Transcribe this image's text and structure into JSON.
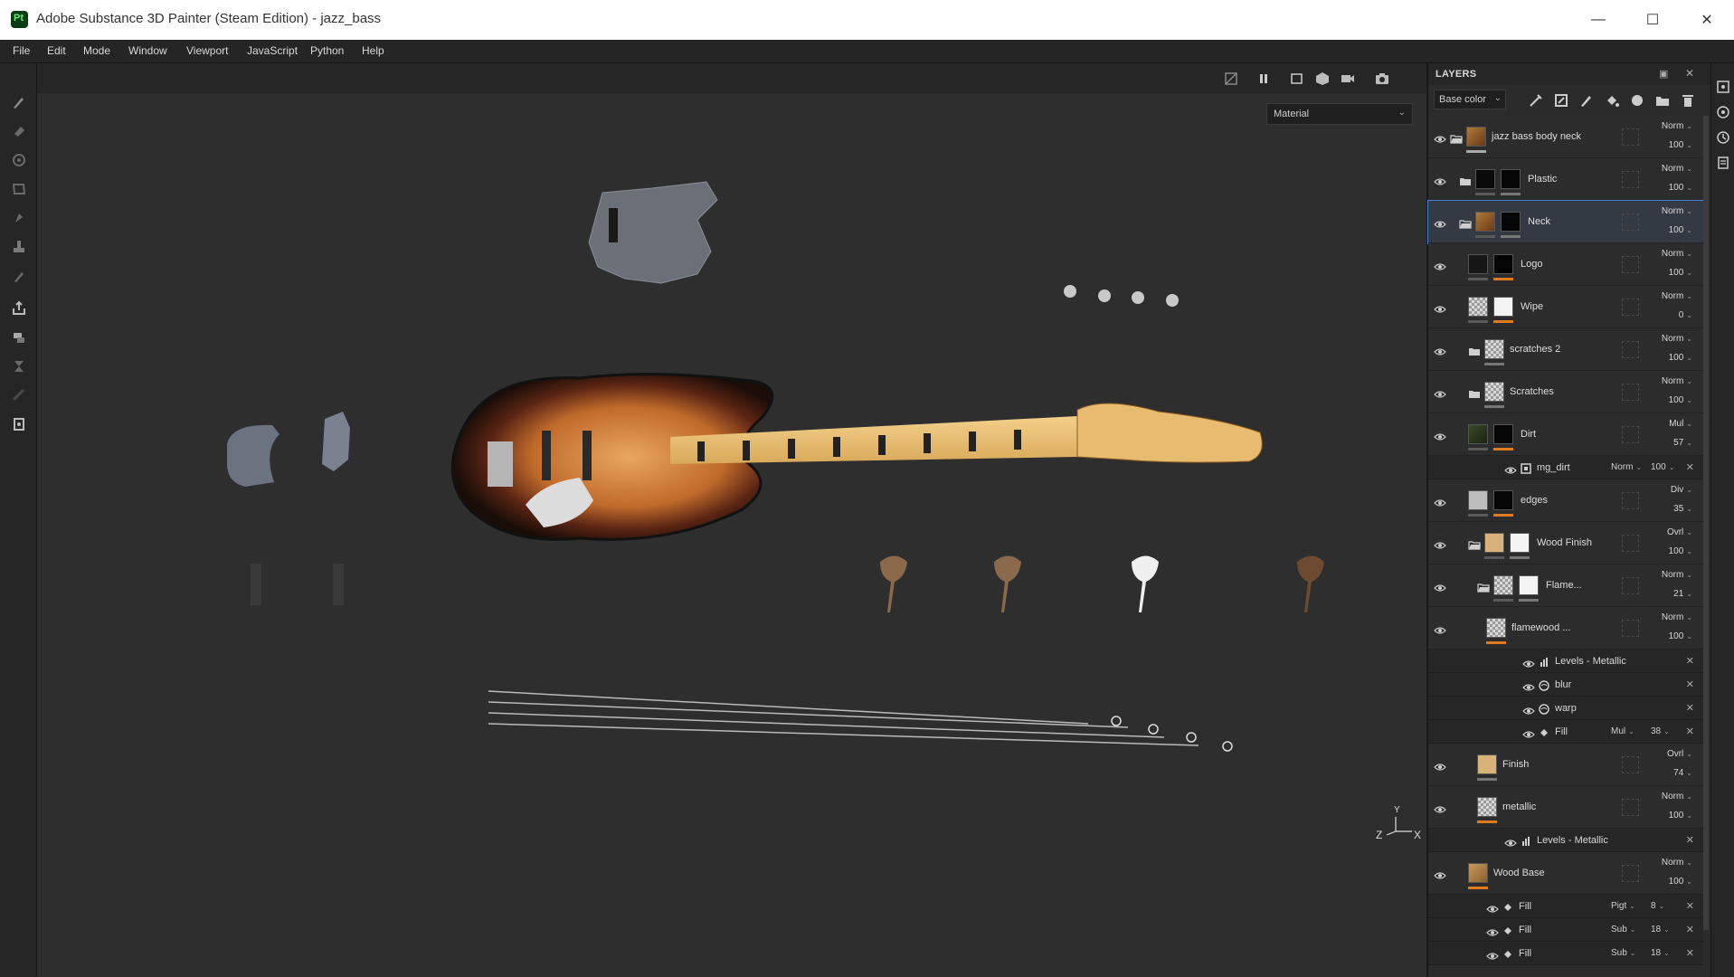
{
  "window": {
    "title": "Adobe Substance 3D Painter (Steam Edition) - jazz_bass",
    "app_badge": "Pt",
    "minimize_label": "—",
    "maximize_label": "☐",
    "close_label": "✕"
  },
  "menu": [
    "File",
    "Edit",
    "Mode",
    "Window",
    "Viewport",
    "JavaScript",
    "Python",
    "Help"
  ],
  "viewport": {
    "display_mode": "Material",
    "axis_labels": {
      "y": "Y",
      "z": "Z",
      "x": "X"
    }
  },
  "layers_panel": {
    "title": "LAYERS",
    "channel": "Base color",
    "layers": [
      {
        "name": "jazz bass body neck",
        "blend": "Norm",
        "opacity": "100"
      },
      {
        "name": "Plastic",
        "blend": "Norm",
        "opacity": "100"
      },
      {
        "name": "Neck",
        "blend": "Norm",
        "opacity": "100"
      },
      {
        "name": "Logo",
        "blend": "Norm",
        "opacity": "100"
      },
      {
        "name": "Wipe",
        "blend": "Norm",
        "opacity": "0"
      },
      {
        "name": "scratches 2",
        "blend": "Norm",
        "opacity": "100"
      },
      {
        "name": "Scratches",
        "blend": "Norm",
        "opacity": "100"
      },
      {
        "name": "Dirt",
        "blend": "Mul",
        "opacity": "57"
      },
      {
        "name": "edges",
        "blend": "Div",
        "opacity": "35"
      },
      {
        "name": "Wood Finish",
        "blend": "Ovrl",
        "opacity": "100"
      },
      {
        "name": "Flame...",
        "blend": "Norm",
        "opacity": "21"
      },
      {
        "name": "flamewood ...",
        "blend": "Norm",
        "opacity": "100"
      },
      {
        "name": "Finish",
        "blend": "Ovrl",
        "opacity": "74"
      },
      {
        "name": "metallic",
        "blend": "Norm",
        "opacity": "100"
      },
      {
        "name": "Wood Base",
        "blend": "Norm",
        "opacity": "100"
      }
    ],
    "effects": [
      {
        "name": "mg_dirt",
        "blend": "Norm",
        "opacity": "100"
      },
      {
        "name": "Levels - Metallic"
      },
      {
        "name": "blur"
      },
      {
        "name": "warp"
      },
      {
        "name": "Fill",
        "blend": "Mul",
        "opacity": "38"
      },
      {
        "name": "Levels - Metallic"
      },
      {
        "name": "Fill",
        "blend": "Pigt",
        "opacity": "8"
      },
      {
        "name": "Fill",
        "blend": "Sub",
        "opacity": "18"
      },
      {
        "name": "Fill",
        "blend": "Sub",
        "opacity": "18"
      }
    ]
  },
  "colors": {
    "accent_orange": "#e07a1f",
    "selection_blue": "#4a7bd0",
    "panel_bg": "#2b2b2b",
    "viewport_bg": "#2e2e2e"
  }
}
